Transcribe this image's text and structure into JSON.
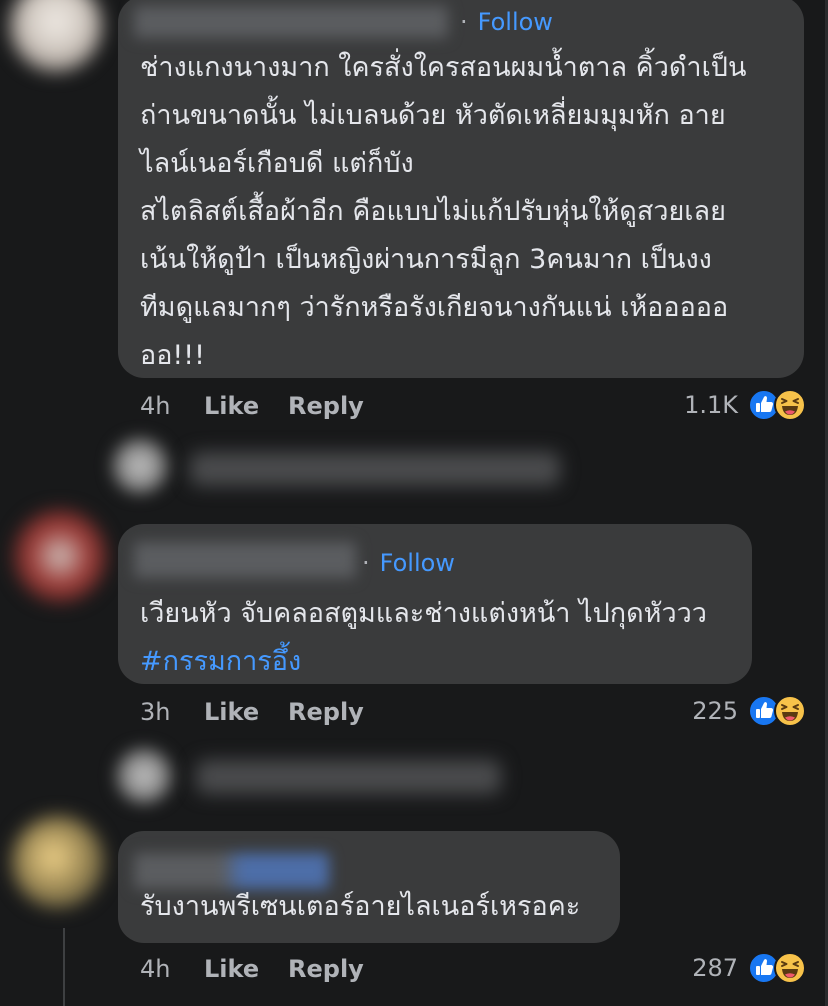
{
  "comments": [
    {
      "follow_separator": "·",
      "follow_label": "Follow",
      "lines": [
        "ช่างแกงนางมาก ใครสั่งใครสอนผมน้ำตาล คิ้วดำเป็น",
        "ถ่านขนาดนั้น ไม่เบลนด้วย หัวตัดเหลี่ยมมุมหัก อาย",
        "ไลน์เนอร์เกือบดี แต่ก็บัง",
        "สไตลิสต์เสื้อผ้าอีก คือแบบไม่แก้ปรับหุ่นให้ดูสวยเลย",
        "เน้นให้ดูป้า เป็นหญิงผ่านการมีลูก 3คนมาก เป็นงง",
        "ทีมดูแลมากๆ ว่ารักหรือรังเกียจนางกันแน่ เห้อออออ",
        "ออ!!!"
      ],
      "time": "4h",
      "like_label": "Like",
      "reply_label": "Reply",
      "reaction_count": "1.1K",
      "reactions": [
        "like-icon",
        "haha-icon"
      ]
    },
    {
      "follow_separator": "·",
      "follow_label": "Follow",
      "lines": [
        "เวียนหัว จับคลอสตูมและช่างแต่งหน้า ไปกุดหัววว"
      ],
      "hashtag": "#กรรมการอึ้ง",
      "time": "3h",
      "like_label": "Like",
      "reply_label": "Reply",
      "reaction_count": "225",
      "reactions": [
        "like-icon",
        "haha-icon"
      ]
    },
    {
      "lines": [
        "รับงานพรีเซนเตอร์อายไลเนอร์เหรอคะ"
      ],
      "time": "4h",
      "like_label": "Like",
      "reply_label": "Reply",
      "reaction_count": "287",
      "reactions": [
        "like-icon",
        "haha-icon"
      ]
    }
  ],
  "colors": {
    "background": "#18191a",
    "bubble": "#3a3b3c",
    "text": "#e4e6eb",
    "secondary_text": "#b0b3b8",
    "link": "#4599ff",
    "like_blue": "#1877f2",
    "haha_yellow": "#f7c24a"
  }
}
